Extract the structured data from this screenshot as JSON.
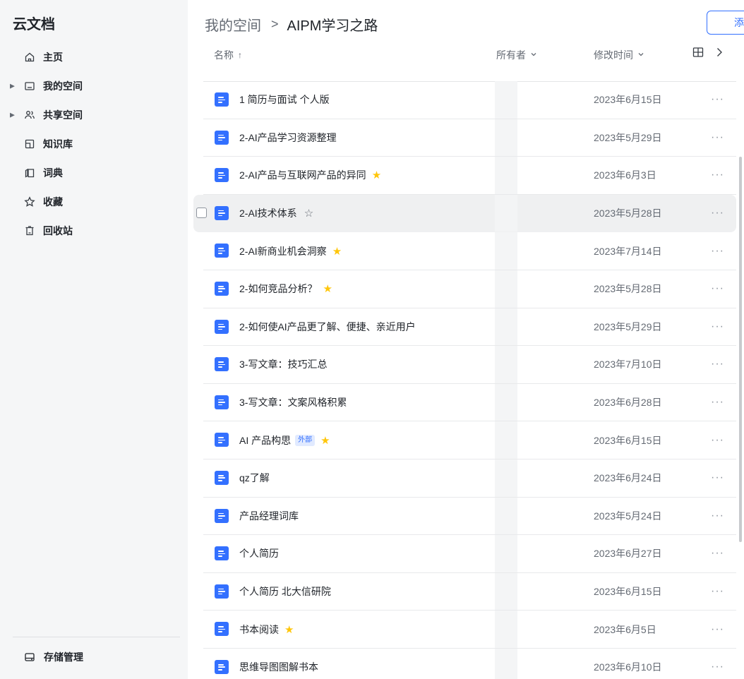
{
  "app": {
    "title": "云文档"
  },
  "sidebar": {
    "items": [
      {
        "label": "主页",
        "icon": "home-icon",
        "expandable": false
      },
      {
        "label": "我的空间",
        "icon": "folder-icon",
        "expandable": true
      },
      {
        "label": "共享空间",
        "icon": "people-icon",
        "expandable": true
      },
      {
        "label": "知识库",
        "icon": "book-icon",
        "expandable": false
      },
      {
        "label": "词典",
        "icon": "dictionary-icon",
        "expandable": false
      },
      {
        "label": "收藏",
        "icon": "star-icon",
        "expandable": false
      },
      {
        "label": "回收站",
        "icon": "trash-icon",
        "expandable": false
      }
    ],
    "storage_label": "存储管理"
  },
  "breadcrumb": {
    "root": "我的空间",
    "separator": ">",
    "current": "AIPM学习之路"
  },
  "toolbar": {
    "add_label": "添加"
  },
  "table": {
    "headers": {
      "name": "名称",
      "owner": "所有者",
      "mtime": "修改时间"
    },
    "rows": [
      {
        "title": "1 简历与面试 个人版",
        "mtime": "2023年6月15日",
        "star": false
      },
      {
        "title": "2-AI产品学习资源整理",
        "mtime": "2023年5月29日",
        "star": false
      },
      {
        "title": "2-AI产品与互联网产品的异同",
        "mtime": "2023年6月3日",
        "star": true
      },
      {
        "title": "2-AI技术体系",
        "mtime": "2023年5月28日",
        "star": false,
        "hover": true
      },
      {
        "title": "2-AI新商业机会洞察",
        "mtime": "2023年7月14日",
        "star": true
      },
      {
        "title": "2-如何竞品分析？",
        "mtime": "2023年5月28日",
        "star": true
      },
      {
        "title": "2-如何使AI产品更了解、便捷、亲近用户",
        "mtime": "2023年5月29日",
        "star": false
      },
      {
        "title": "3-写文章：技巧汇总",
        "mtime": "2023年7月10日",
        "star": false
      },
      {
        "title": "3-写文章：文案风格积累",
        "mtime": "2023年6月28日",
        "star": false
      },
      {
        "title": "AI 产品构思",
        "mtime": "2023年6月15日",
        "star": true,
        "tag": "外部"
      },
      {
        "title": "qz了解",
        "mtime": "2023年6月24日",
        "star": false
      },
      {
        "title": "产品经理词库",
        "mtime": "2023年5月24日",
        "star": false
      },
      {
        "title": "个人简历",
        "mtime": "2023年6月27日",
        "star": false
      },
      {
        "title": "个人简历 北大信研院",
        "mtime": "2023年6月15日",
        "star": false
      },
      {
        "title": "书本阅读",
        "mtime": "2023年6月5日",
        "star": true
      },
      {
        "title": "思维导图图解书本",
        "mtime": "2023年6月10日",
        "star": false
      }
    ],
    "more_label": "···"
  },
  "colors": {
    "accent": "#3370ff",
    "star": "#ffc60a",
    "sidebar_bg": "#f5f6f7"
  }
}
